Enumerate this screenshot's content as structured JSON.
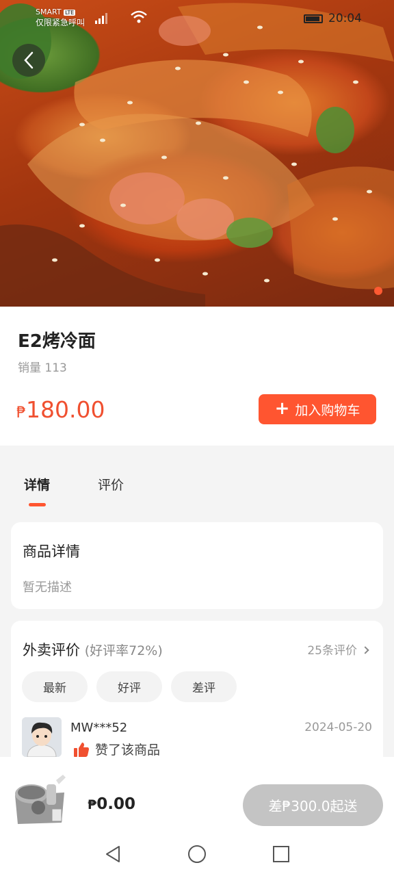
{
  "status_bar": {
    "carrier_line1": "SMART",
    "carrier_badge": "LTE",
    "carrier_line2": "仅限紧急呼叫",
    "time": "20:04"
  },
  "product": {
    "name": "E2烤冷面",
    "sales": "销量 113",
    "currency": "₱",
    "price": "180.00",
    "add_to_cart_label": "加入购物车"
  },
  "tabs": [
    {
      "label": "详情",
      "active": true
    },
    {
      "label": "评价",
      "active": false
    }
  ],
  "details": {
    "title": "商品详情",
    "description": "暂无描述"
  },
  "reviews": {
    "title": "外卖评价",
    "positive_rate": "(好评率72%)",
    "count_label": "25条评价",
    "filters": [
      "最新",
      "好评",
      "差评"
    ],
    "items": [
      {
        "user": "MW***52",
        "date": "2024-05-20",
        "text": "赞了该商品"
      }
    ]
  },
  "cart": {
    "currency": "₱",
    "total": "0.00",
    "checkout_label": "差₱300.0起送"
  },
  "colors": {
    "accent": "#ff5530",
    "price": "#f05030",
    "disabled": "#c4c4c4"
  }
}
